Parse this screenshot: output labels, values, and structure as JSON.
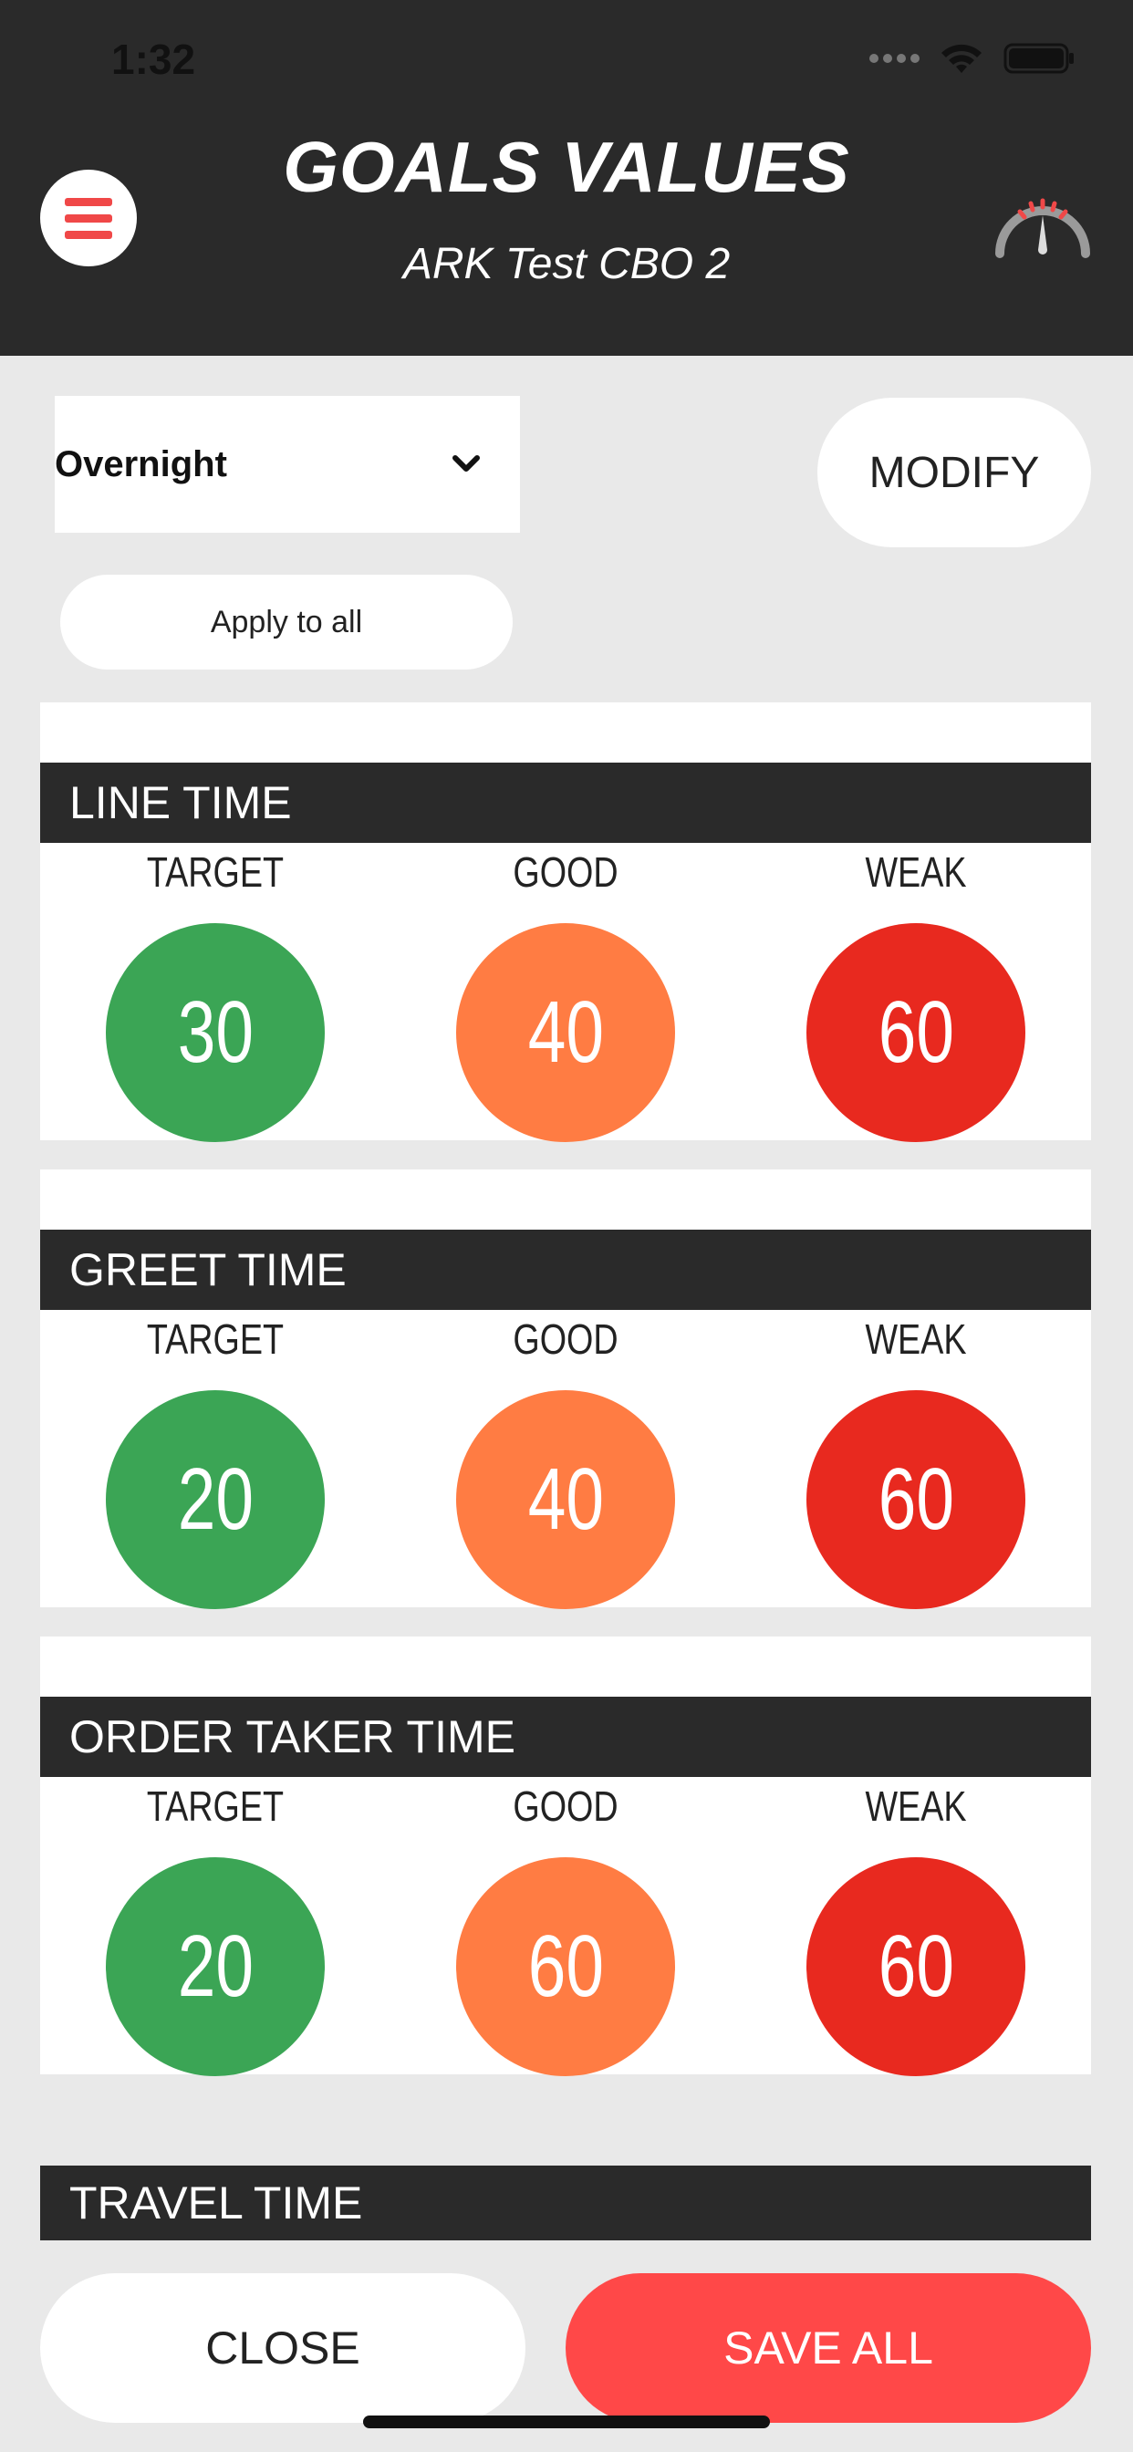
{
  "status_bar": {
    "time": "1:32"
  },
  "header": {
    "title": "GOALS VALUES",
    "subtitle": "ARK Test CBO 2",
    "menu_icon": "hamburger-icon",
    "right_icon": "speedometer-icon",
    "accent_color": "#f04848"
  },
  "controls": {
    "daypart_selected": "Overnight",
    "modify_label": "MODIFY",
    "apply_label": "Apply to all"
  },
  "metrics": [
    {
      "title": "LINE TIME",
      "values": [
        {
          "label": "TARGET",
          "value": "30",
          "color": "#3ba555"
        },
        {
          "label": "GOOD",
          "value": "40",
          "color": "#ff7c43"
        },
        {
          "label": "WEAK",
          "value": "60",
          "color": "#e8291f"
        }
      ]
    },
    {
      "title": "GREET TIME",
      "values": [
        {
          "label": "TARGET",
          "value": "20",
          "color": "#3ba555"
        },
        {
          "label": "GOOD",
          "value": "40",
          "color": "#ff7c43"
        },
        {
          "label": "WEAK",
          "value": "60",
          "color": "#e8291f"
        }
      ]
    },
    {
      "title": "ORDER TAKER TIME",
      "values": [
        {
          "label": "TARGET",
          "value": "20",
          "color": "#3ba555"
        },
        {
          "label": "GOOD",
          "value": "60",
          "color": "#ff7c43"
        },
        {
          "label": "WEAK",
          "value": "60",
          "color": "#e8291f"
        }
      ]
    },
    {
      "title": "TRAVEL TIME"
    }
  ],
  "footer": {
    "close_label": "CLOSE",
    "save_label": "SAVE ALL",
    "save_color": "#ff4848"
  }
}
